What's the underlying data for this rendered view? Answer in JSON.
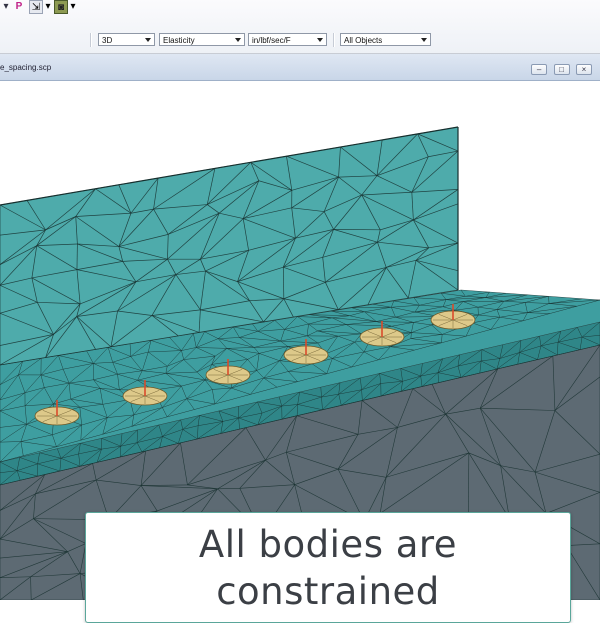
{
  "toolbar": {
    "view_mode": "3D",
    "analysis_type": "Elasticity",
    "units": "in/lbf/sec/F",
    "object_filter": "All Objects",
    "p_icon_label": "P"
  },
  "document": {
    "tab_name": "e_spacing.scp"
  },
  "window_buttons": {
    "minimize": "–",
    "restore": "□",
    "close": "×"
  },
  "caption": {
    "text": "All bodies are constrained"
  },
  "colors": {
    "wall": "#4eabab",
    "plate": "#3e9ea0",
    "ground": "#5d6a73",
    "weld": "#ddc98a",
    "mesh_line": "#17302f",
    "arrow": "#d94b2b"
  },
  "icons": [
    "dropdown-arrow-icon",
    "pen-icon",
    "pointer-icon",
    "camera-icon",
    "minimize-icon",
    "restore-icon",
    "close-icon"
  ]
}
